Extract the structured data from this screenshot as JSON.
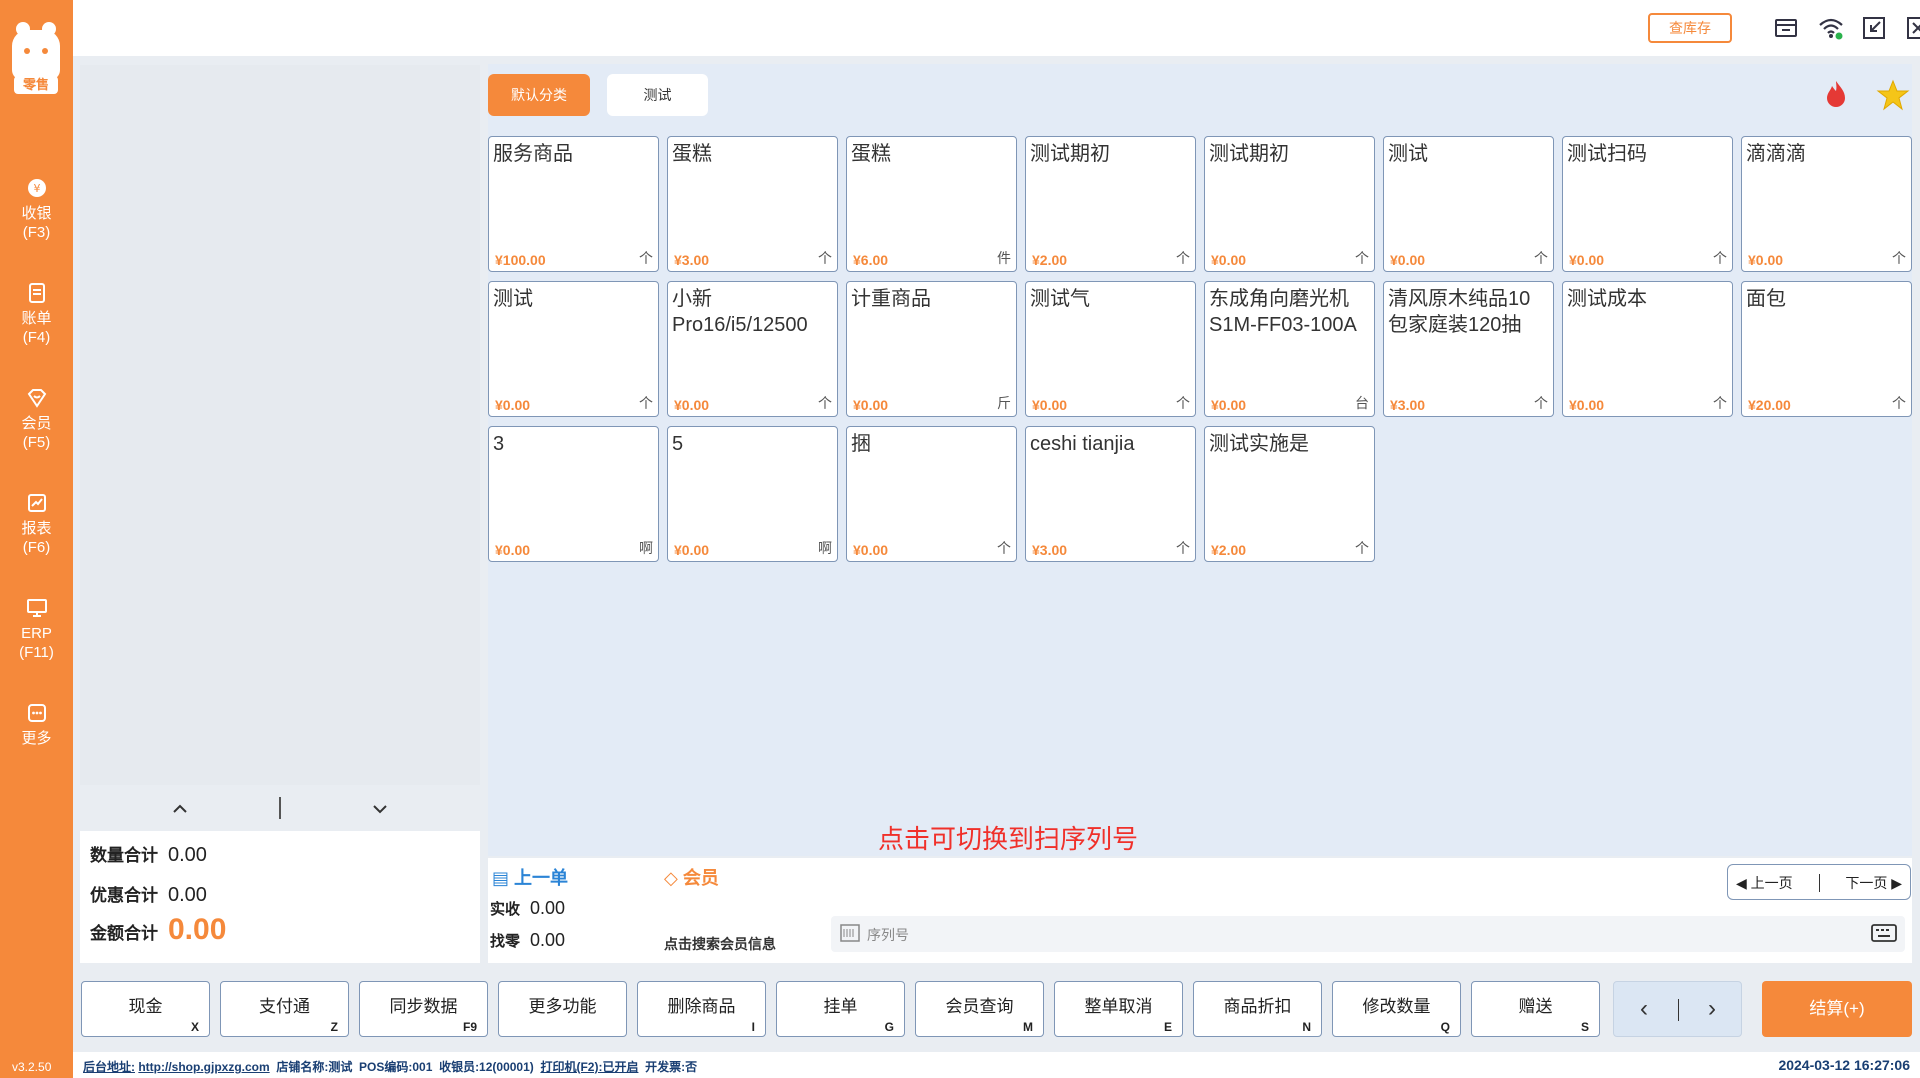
{
  "sidebar": {
    "logo_tag": "零售",
    "items": [
      {
        "label": "收银",
        "key": "(F3)",
        "icon": "cash-register-icon"
      },
      {
        "label": "账单",
        "key": "(F4)",
        "icon": "bill-icon"
      },
      {
        "label": "会员",
        "key": "(F5)",
        "icon": "member-icon"
      },
      {
        "label": "报表",
        "key": "(F6)",
        "icon": "report-icon"
      },
      {
        "label": "ERP",
        "key": "(F11)",
        "icon": "erp-icon"
      },
      {
        "label": "更多",
        "key": "",
        "icon": "more-icon"
      }
    ],
    "version": "v3.2.50"
  },
  "topbar": {
    "stock_button": "查库存",
    "icons": [
      "cash-drawer-icon",
      "wifi-icon",
      "shrink-icon",
      "close-icon"
    ]
  },
  "totals": {
    "quantity_label": "数量合计",
    "quantity_value": "0.00",
    "discount_label": "优惠合计",
    "discount_value": "0.00",
    "amount_label": "金额合计",
    "amount_value": "0.00"
  },
  "categories": [
    {
      "label": "默认分类",
      "active": true
    },
    {
      "label": "测试",
      "active": false
    }
  ],
  "products": [
    {
      "name": "服务商品",
      "price": "¥100.00",
      "unit": "个"
    },
    {
      "name": "蛋糕",
      "price": "¥3.00",
      "unit": "个"
    },
    {
      "name": "蛋糕",
      "price": "¥6.00",
      "unit": "件"
    },
    {
      "name": "测试期初",
      "price": "¥2.00",
      "unit": "个"
    },
    {
      "name": "测试期初",
      "price": "¥0.00",
      "unit": "个"
    },
    {
      "name": "测试",
      "price": "¥0.00",
      "unit": "个"
    },
    {
      "name": "测试扫码",
      "price": "¥0.00",
      "unit": "个"
    },
    {
      "name": "滴滴滴",
      "price": "¥0.00",
      "unit": "个"
    },
    {
      "name": "测试",
      "price": "¥0.00",
      "unit": "个"
    },
    {
      "name": "小新Pro16/i5/12500",
      "price": "¥0.00",
      "unit": "个"
    },
    {
      "name": "计重商品",
      "price": "¥0.00",
      "unit": "斤"
    },
    {
      "name": "测试气",
      "price": "¥0.00",
      "unit": "个"
    },
    {
      "name": "东成角向磨光机S1M-FF03-100A",
      "price": "¥0.00",
      "unit": "台"
    },
    {
      "name": "清风原木纯品10包家庭装120抽",
      "price": "¥3.00",
      "unit": "个"
    },
    {
      "name": "测试成本",
      "price": "¥0.00",
      "unit": "个"
    },
    {
      "name": "面包",
      "price": "¥20.00",
      "unit": "个"
    },
    {
      "name": "3",
      "price": "¥0.00",
      "unit": "啊"
    },
    {
      "name": "5",
      "price": "¥0.00",
      "unit": "啊"
    },
    {
      "name": "捆",
      "price": "¥0.00",
      "unit": "个"
    },
    {
      "name": "ceshi tianjia",
      "price": "¥3.00",
      "unit": "个"
    },
    {
      "name": "测试实施是",
      "price": "¥2.00",
      "unit": "个"
    }
  ],
  "annotation": "点击可切换到扫序列号",
  "info": {
    "prev_order": "上一单",
    "member": "会员",
    "received_label": "实收",
    "received_value": "0.00",
    "change_label": "找零",
    "change_value": "0.00",
    "member_search": "点击搜索会员信息",
    "serial_placeholder": "序列号",
    "prev_page": "上一页",
    "next_page": "下一页"
  },
  "functions": [
    {
      "label": "现金",
      "key": "X"
    },
    {
      "label": "支付通",
      "key": "Z"
    },
    {
      "label": "同步数据",
      "key": "F9"
    },
    {
      "label": "更多功能",
      "key": ""
    },
    {
      "label": "删除商品",
      "key": "I"
    },
    {
      "label": "挂单",
      "key": "G"
    },
    {
      "label": "会员查询",
      "key": "M"
    },
    {
      "label": "整单取消",
      "key": "E"
    },
    {
      "label": "商品折扣",
      "key": "N"
    },
    {
      "label": "修改数量",
      "key": "Q"
    },
    {
      "label": "赠送",
      "key": "S"
    }
  ],
  "checkout": "结算(+)",
  "status": {
    "backend_label": "后台地址:",
    "backend_url": "http://shop.gjpxzg.com",
    "store": "店铺名称:测试",
    "pos": "POS编码:001",
    "cashier": "收银员:12(00001)",
    "printer": "打印机(F2):已开启",
    "invoice": "开发票:否",
    "datetime": "2024-03-12 16:27:06"
  },
  "colors": {
    "accent": "#f5893b",
    "blue": "#2b84d6",
    "annotation": "#f0302a"
  }
}
